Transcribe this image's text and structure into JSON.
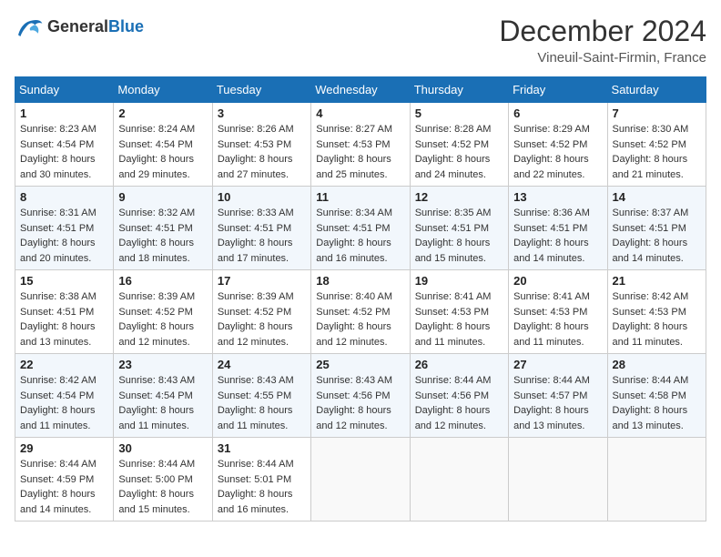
{
  "header": {
    "logo": {
      "general": "General",
      "blue": "Blue"
    },
    "title": "December 2024",
    "location": "Vineuil-Saint-Firmin, France"
  },
  "weekdays": [
    "Sunday",
    "Monday",
    "Tuesday",
    "Wednesday",
    "Thursday",
    "Friday",
    "Saturday"
  ],
  "weeks": [
    [
      {
        "day": "1",
        "sunrise": "Sunrise: 8:23 AM",
        "sunset": "Sunset: 4:54 PM",
        "daylight": "Daylight: 8 hours and 30 minutes."
      },
      {
        "day": "2",
        "sunrise": "Sunrise: 8:24 AM",
        "sunset": "Sunset: 4:54 PM",
        "daylight": "Daylight: 8 hours and 29 minutes."
      },
      {
        "day": "3",
        "sunrise": "Sunrise: 8:26 AM",
        "sunset": "Sunset: 4:53 PM",
        "daylight": "Daylight: 8 hours and 27 minutes."
      },
      {
        "day": "4",
        "sunrise": "Sunrise: 8:27 AM",
        "sunset": "Sunset: 4:53 PM",
        "daylight": "Daylight: 8 hours and 25 minutes."
      },
      {
        "day": "5",
        "sunrise": "Sunrise: 8:28 AM",
        "sunset": "Sunset: 4:52 PM",
        "daylight": "Daylight: 8 hours and 24 minutes."
      },
      {
        "day": "6",
        "sunrise": "Sunrise: 8:29 AM",
        "sunset": "Sunset: 4:52 PM",
        "daylight": "Daylight: 8 hours and 22 minutes."
      },
      {
        "day": "7",
        "sunrise": "Sunrise: 8:30 AM",
        "sunset": "Sunset: 4:52 PM",
        "daylight": "Daylight: 8 hours and 21 minutes."
      }
    ],
    [
      {
        "day": "8",
        "sunrise": "Sunrise: 8:31 AM",
        "sunset": "Sunset: 4:51 PM",
        "daylight": "Daylight: 8 hours and 20 minutes."
      },
      {
        "day": "9",
        "sunrise": "Sunrise: 8:32 AM",
        "sunset": "Sunset: 4:51 PM",
        "daylight": "Daylight: 8 hours and 18 minutes."
      },
      {
        "day": "10",
        "sunrise": "Sunrise: 8:33 AM",
        "sunset": "Sunset: 4:51 PM",
        "daylight": "Daylight: 8 hours and 17 minutes."
      },
      {
        "day": "11",
        "sunrise": "Sunrise: 8:34 AM",
        "sunset": "Sunset: 4:51 PM",
        "daylight": "Daylight: 8 hours and 16 minutes."
      },
      {
        "day": "12",
        "sunrise": "Sunrise: 8:35 AM",
        "sunset": "Sunset: 4:51 PM",
        "daylight": "Daylight: 8 hours and 15 minutes."
      },
      {
        "day": "13",
        "sunrise": "Sunrise: 8:36 AM",
        "sunset": "Sunset: 4:51 PM",
        "daylight": "Daylight: 8 hours and 14 minutes."
      },
      {
        "day": "14",
        "sunrise": "Sunrise: 8:37 AM",
        "sunset": "Sunset: 4:51 PM",
        "daylight": "Daylight: 8 hours and 14 minutes."
      }
    ],
    [
      {
        "day": "15",
        "sunrise": "Sunrise: 8:38 AM",
        "sunset": "Sunset: 4:51 PM",
        "daylight": "Daylight: 8 hours and 13 minutes."
      },
      {
        "day": "16",
        "sunrise": "Sunrise: 8:39 AM",
        "sunset": "Sunset: 4:52 PM",
        "daylight": "Daylight: 8 hours and 12 minutes."
      },
      {
        "day": "17",
        "sunrise": "Sunrise: 8:39 AM",
        "sunset": "Sunset: 4:52 PM",
        "daylight": "Daylight: 8 hours and 12 minutes."
      },
      {
        "day": "18",
        "sunrise": "Sunrise: 8:40 AM",
        "sunset": "Sunset: 4:52 PM",
        "daylight": "Daylight: 8 hours and 12 minutes."
      },
      {
        "day": "19",
        "sunrise": "Sunrise: 8:41 AM",
        "sunset": "Sunset: 4:53 PM",
        "daylight": "Daylight: 8 hours and 11 minutes."
      },
      {
        "day": "20",
        "sunrise": "Sunrise: 8:41 AM",
        "sunset": "Sunset: 4:53 PM",
        "daylight": "Daylight: 8 hours and 11 minutes."
      },
      {
        "day": "21",
        "sunrise": "Sunrise: 8:42 AM",
        "sunset": "Sunset: 4:53 PM",
        "daylight": "Daylight: 8 hours and 11 minutes."
      }
    ],
    [
      {
        "day": "22",
        "sunrise": "Sunrise: 8:42 AM",
        "sunset": "Sunset: 4:54 PM",
        "daylight": "Daylight: 8 hours and 11 minutes."
      },
      {
        "day": "23",
        "sunrise": "Sunrise: 8:43 AM",
        "sunset": "Sunset: 4:54 PM",
        "daylight": "Daylight: 8 hours and 11 minutes."
      },
      {
        "day": "24",
        "sunrise": "Sunrise: 8:43 AM",
        "sunset": "Sunset: 4:55 PM",
        "daylight": "Daylight: 8 hours and 11 minutes."
      },
      {
        "day": "25",
        "sunrise": "Sunrise: 8:43 AM",
        "sunset": "Sunset: 4:56 PM",
        "daylight": "Daylight: 8 hours and 12 minutes."
      },
      {
        "day": "26",
        "sunrise": "Sunrise: 8:44 AM",
        "sunset": "Sunset: 4:56 PM",
        "daylight": "Daylight: 8 hours and 12 minutes."
      },
      {
        "day": "27",
        "sunrise": "Sunrise: 8:44 AM",
        "sunset": "Sunset: 4:57 PM",
        "daylight": "Daylight: 8 hours and 13 minutes."
      },
      {
        "day": "28",
        "sunrise": "Sunrise: 8:44 AM",
        "sunset": "Sunset: 4:58 PM",
        "daylight": "Daylight: 8 hours and 13 minutes."
      }
    ],
    [
      {
        "day": "29",
        "sunrise": "Sunrise: 8:44 AM",
        "sunset": "Sunset: 4:59 PM",
        "daylight": "Daylight: 8 hours and 14 minutes."
      },
      {
        "day": "30",
        "sunrise": "Sunrise: 8:44 AM",
        "sunset": "Sunset: 5:00 PM",
        "daylight": "Daylight: 8 hours and 15 minutes."
      },
      {
        "day": "31",
        "sunrise": "Sunrise: 8:44 AM",
        "sunset": "Sunset: 5:01 PM",
        "daylight": "Daylight: 8 hours and 16 minutes."
      },
      null,
      null,
      null,
      null
    ]
  ]
}
